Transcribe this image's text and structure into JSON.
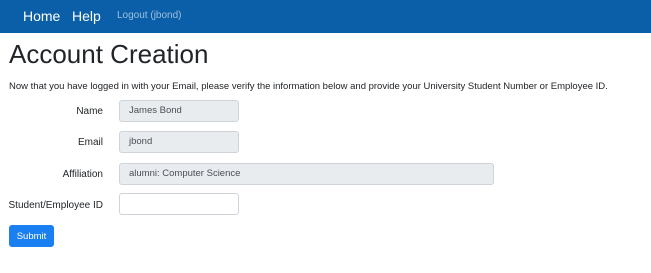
{
  "navbar": {
    "home_label": "Home",
    "help_label": "Help",
    "logout_label": "Logout (jbond)"
  },
  "page": {
    "title": "Account Creation",
    "intro": "Now that you have logged in with your Email, please verify the information below and provide your University Student Number or Employee ID."
  },
  "form": {
    "name": {
      "label": "Name",
      "value": "James Bond"
    },
    "email": {
      "label": "Email",
      "value": "jbond"
    },
    "affiliation": {
      "label": "Affiliation",
      "value": "alumni: Computer Science"
    },
    "student_id": {
      "label": "Student/Employee ID",
      "value": ""
    },
    "submit_label": "Submit"
  },
  "colors": {
    "navbar_background": "#0b5fa8",
    "primary_button": "#1a7ff0",
    "readonly_field_background": "#e9ecef"
  }
}
